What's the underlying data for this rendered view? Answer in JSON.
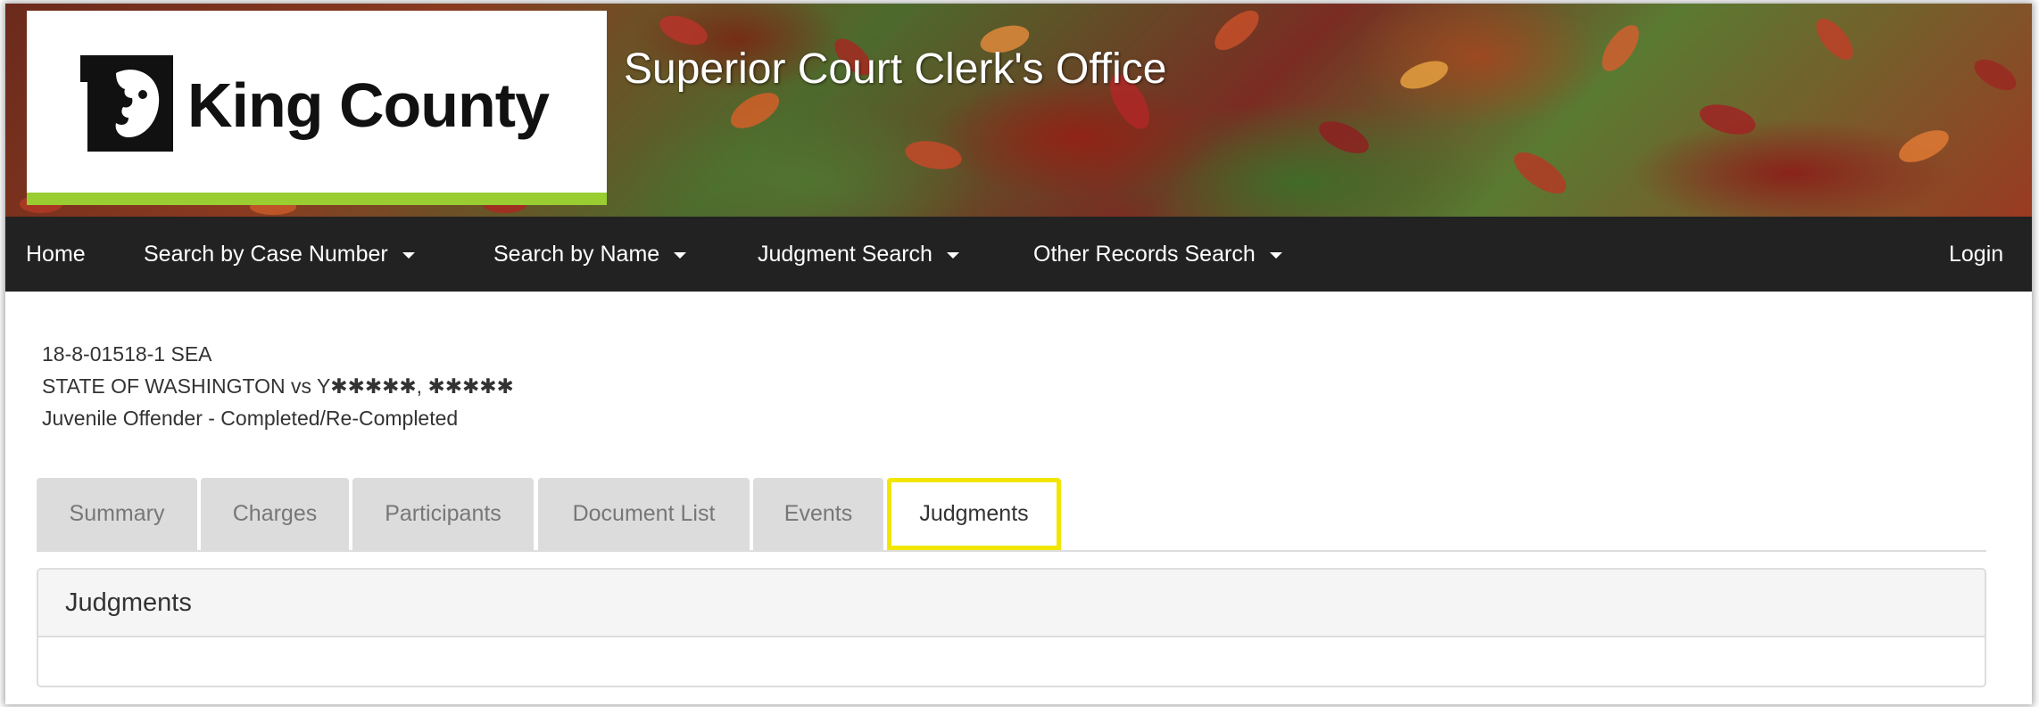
{
  "banner": {
    "logo_text": "King County",
    "site_title": "Superior Court Clerk's Office"
  },
  "nav": {
    "home": "Home",
    "search_case": "Search by Case Number",
    "search_name": "Search by Name",
    "judgment_search": "Judgment Search",
    "other_records": "Other Records Search",
    "login": "Login"
  },
  "case": {
    "number": "18-8-01518-1 SEA",
    "title": "STATE OF WASHINGTON vs Y✱✱✱✱✱, ✱✱✱✱✱",
    "type": "Juvenile Offender - Completed/Re-Completed"
  },
  "tabs": [
    {
      "label": "Summary"
    },
    {
      "label": "Charges"
    },
    {
      "label": "Participants"
    },
    {
      "label": "Document List"
    },
    {
      "label": "Events"
    },
    {
      "label": "Judgments",
      "active": true
    }
  ],
  "panel": {
    "heading": "Judgments"
  },
  "colors": {
    "nav_bg": "#222222",
    "accent_green": "#9acd32",
    "highlight_yellow": "#f2e600",
    "tab_bg": "#dcdcdc"
  }
}
